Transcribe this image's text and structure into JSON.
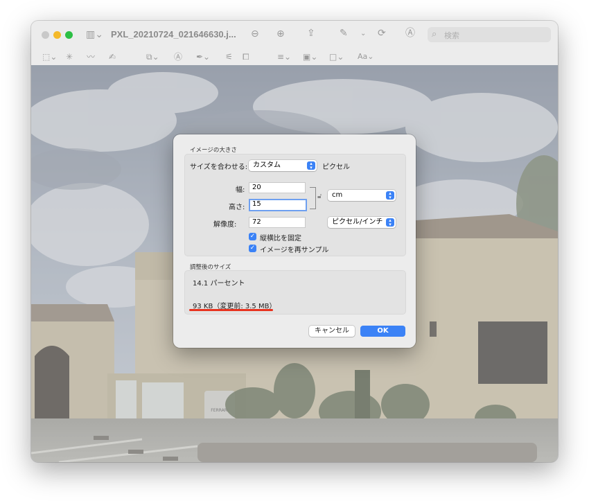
{
  "window": {
    "title": "PXL_20210724_021646630.j...",
    "search_placeholder": "検索"
  },
  "toolbar_icons": [
    "sidebar-icon",
    "zoom-out-icon",
    "zoom-in-icon",
    "share-icon",
    "markup-pen-icon",
    "rotate-icon",
    "markup-circle-icon",
    "rect-select-icon",
    "instant-alpha-icon",
    "sketch-icon",
    "draw-icon",
    "shapes-icon",
    "text-icon",
    "sign-icon",
    "adjust-color-icon",
    "adjust-size-icon",
    "line-style-icon",
    "border-color-icon",
    "fill-color-icon",
    "text-style-icon"
  ],
  "text_style_label": "Aa",
  "dialog": {
    "section1_title": "イメージの大きさ",
    "fit_label": "サイズを合わせる:",
    "fit_value": "カスタム",
    "fit_unit": "ピクセル",
    "width_label": "幅:",
    "width_value": "20",
    "height_label": "高さ:",
    "height_value": "15",
    "unit_value": "cm",
    "resolution_label": "解像度:",
    "resolution_value": "72",
    "resolution_unit": "ピクセル/インチ",
    "checkbox_scale": "縦横比を固定",
    "checkbox_resample": "イメージを再サンプル",
    "section2_title": "調整後のサイズ",
    "percent_text": "14.1 パーセント",
    "size_text": "93 KB（変更前: 3.5 MB）",
    "cancel_label": "キャンセル",
    "ok_label": "OK"
  },
  "photo_sign": "FERRARI",
  "colors": {
    "accent": "#3b82f6",
    "highlight_underline": "#e8321e"
  }
}
